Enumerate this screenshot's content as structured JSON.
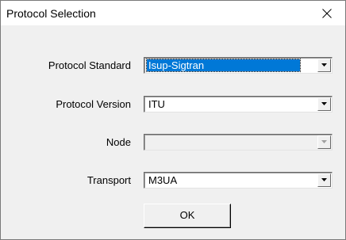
{
  "window": {
    "title": "Protocol Selection"
  },
  "fields": {
    "protocol_standard": {
      "label": "Protocol Standard",
      "value": "Isup-Sigtran"
    },
    "protocol_version": {
      "label": "Protocol Version",
      "value": "ITU"
    },
    "node": {
      "label": "Node",
      "value": ""
    },
    "transport": {
      "label": "Transport",
      "value": "M3UA"
    }
  },
  "buttons": {
    "ok_label": "OK"
  },
  "icons": {
    "close": "close-icon",
    "dropdown": "chevron-down-icon"
  },
  "colors": {
    "selection": "#0078d7",
    "dialog_bg": "#f0f0f0",
    "titlebar_bg": "#ffffff"
  }
}
